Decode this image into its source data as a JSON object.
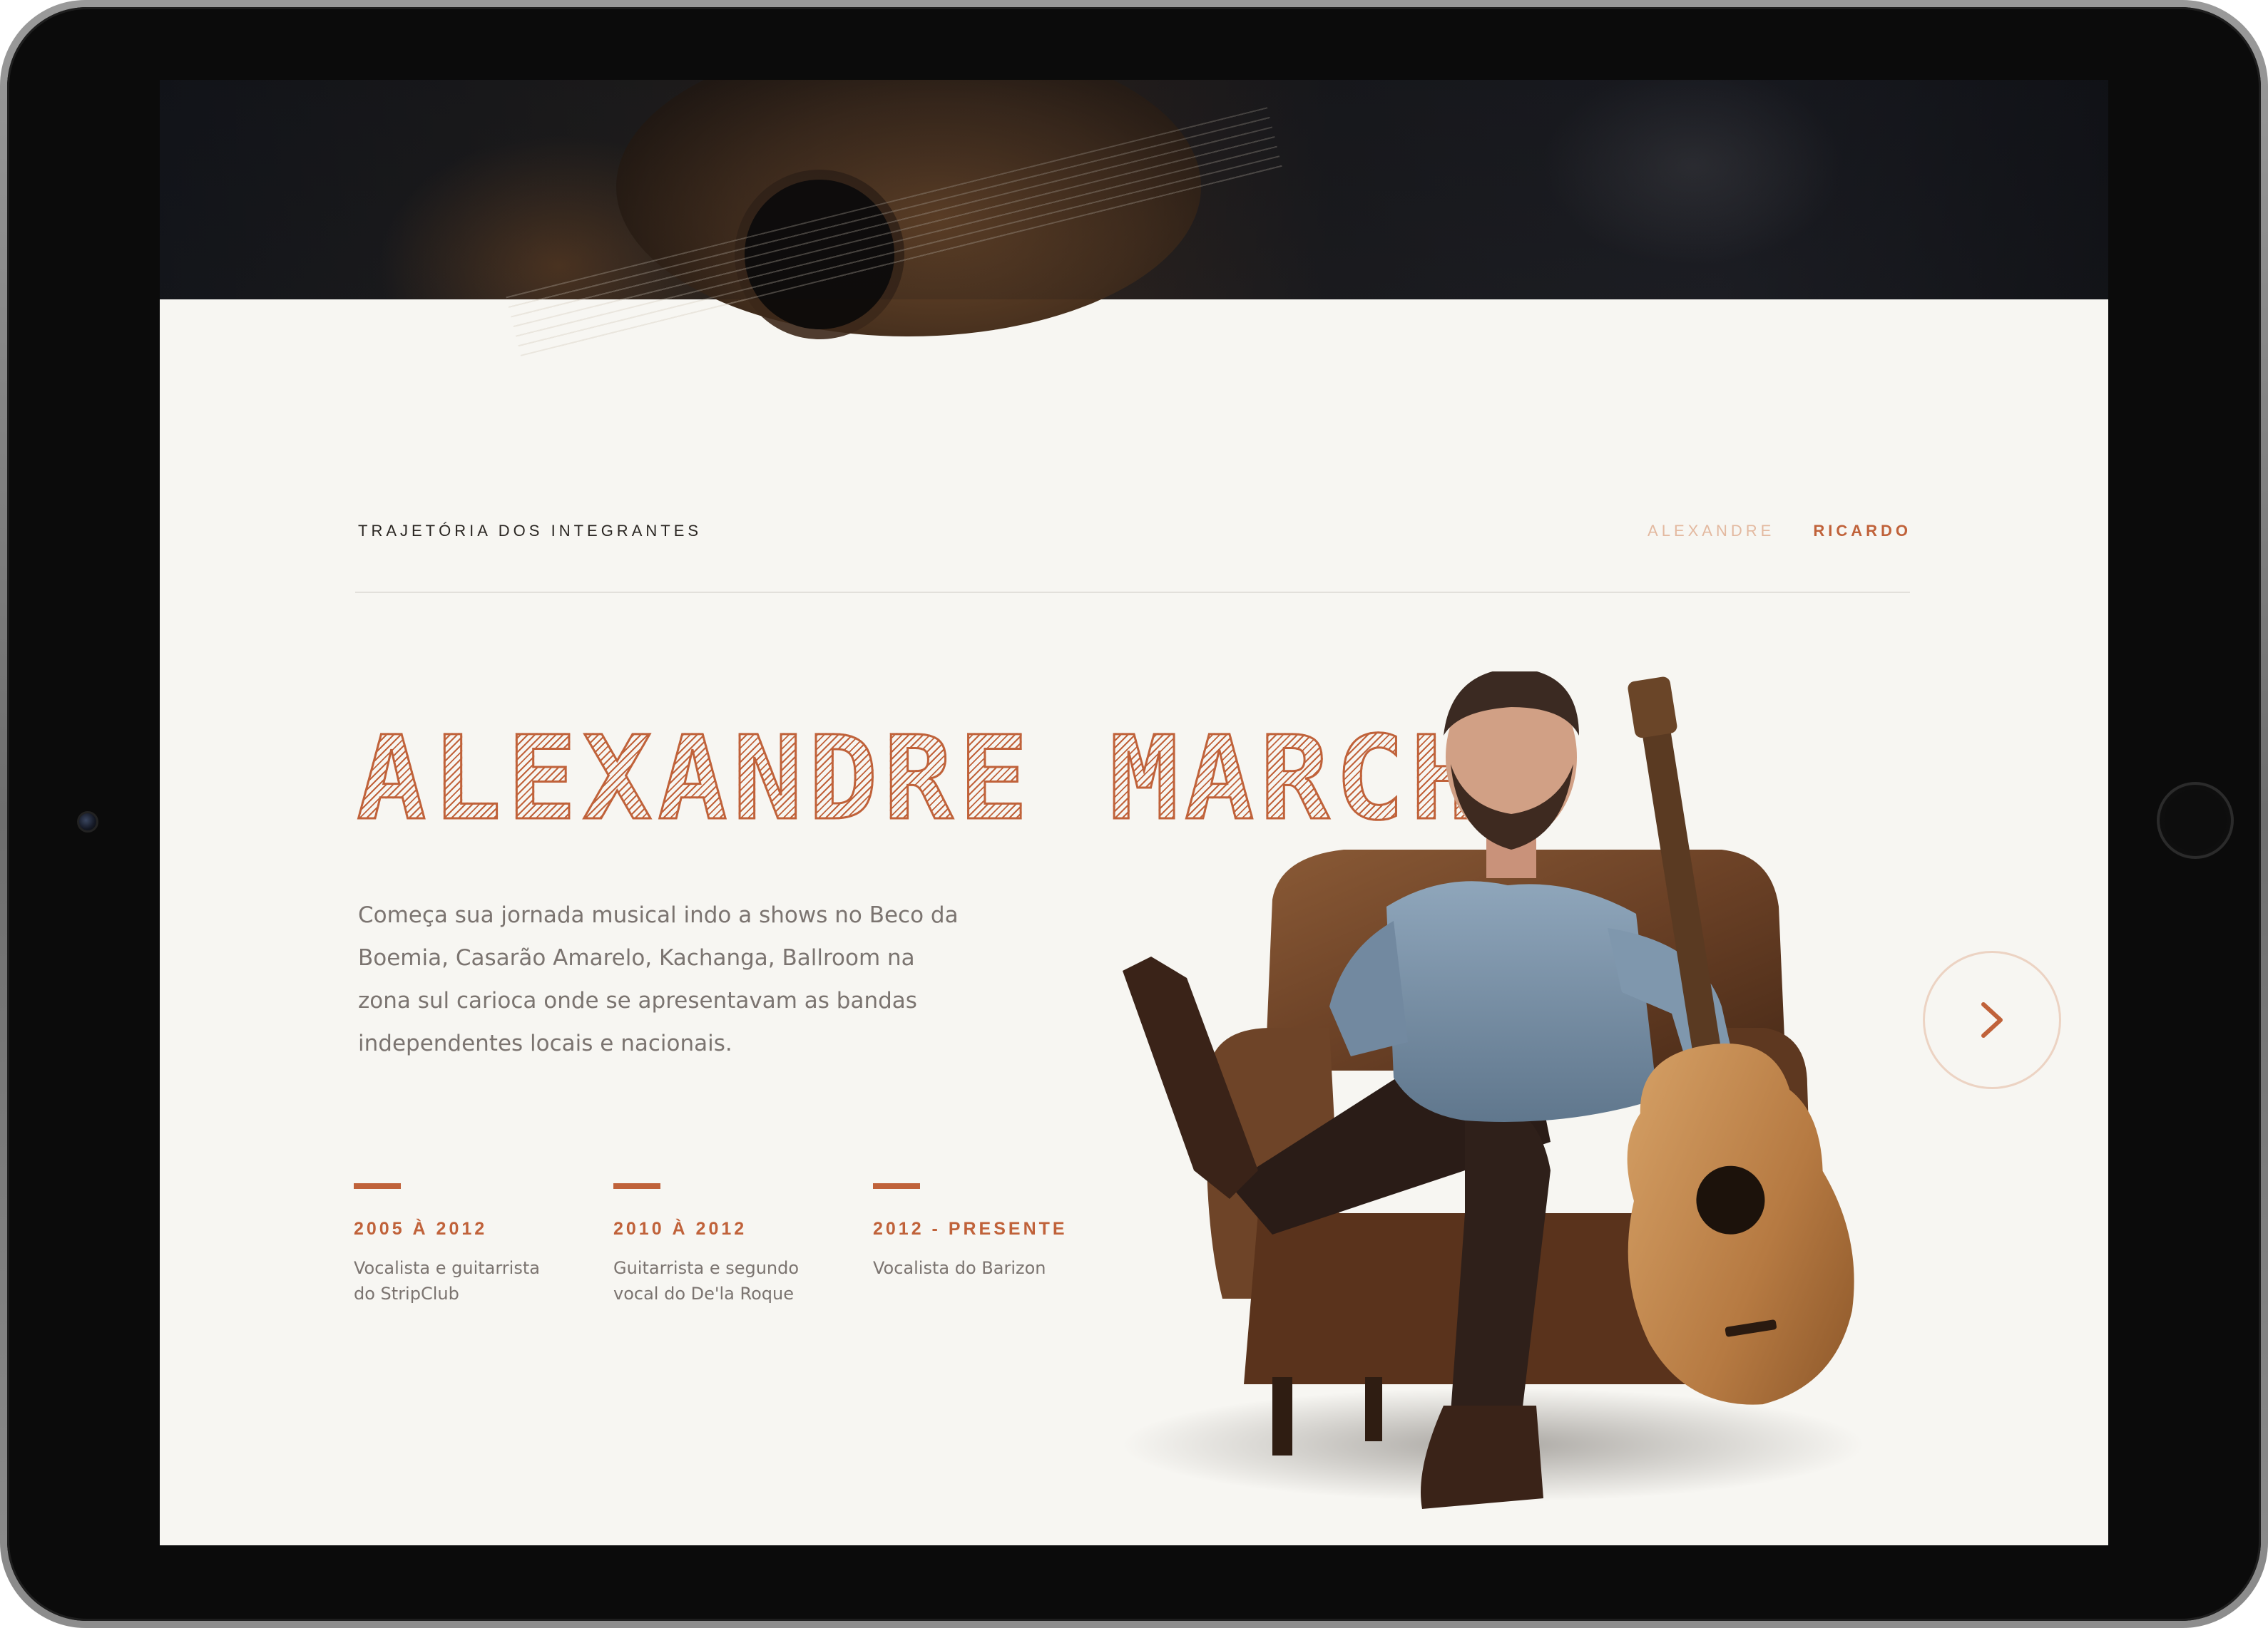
{
  "section": {
    "title": "TRAJETÓRIA DOS INTEGRANTES"
  },
  "nav": {
    "items": [
      {
        "label": "ALEXANDRE"
      },
      {
        "label": "RICARDO"
      }
    ]
  },
  "member": {
    "name": "ALEXANDRE MARCHI",
    "bio": "Começa sua jornada musical indo a shows no Beco da Boemia, Casarão Amarelo, Kachanga, Ballroom na zona sul carioca onde se apresentavam as bandas independentes locais e nacionais."
  },
  "timeline": [
    {
      "period": "2005 À 2012",
      "description": "Vocalista e guitarrista do StripClub"
    },
    {
      "period": "2010 À 2012",
      "description": "Guitarrista e segundo vocal do De'la Roque"
    },
    {
      "period": "2012 - PRESENTE",
      "description": "Vocalista do Barizon"
    }
  ],
  "icons": {
    "next": "chevron-right-icon"
  },
  "colors": {
    "accent": "#c0623a",
    "accent_light": "#e3b9a0",
    "background": "#f7f6f2",
    "text_muted": "#7b7470"
  }
}
